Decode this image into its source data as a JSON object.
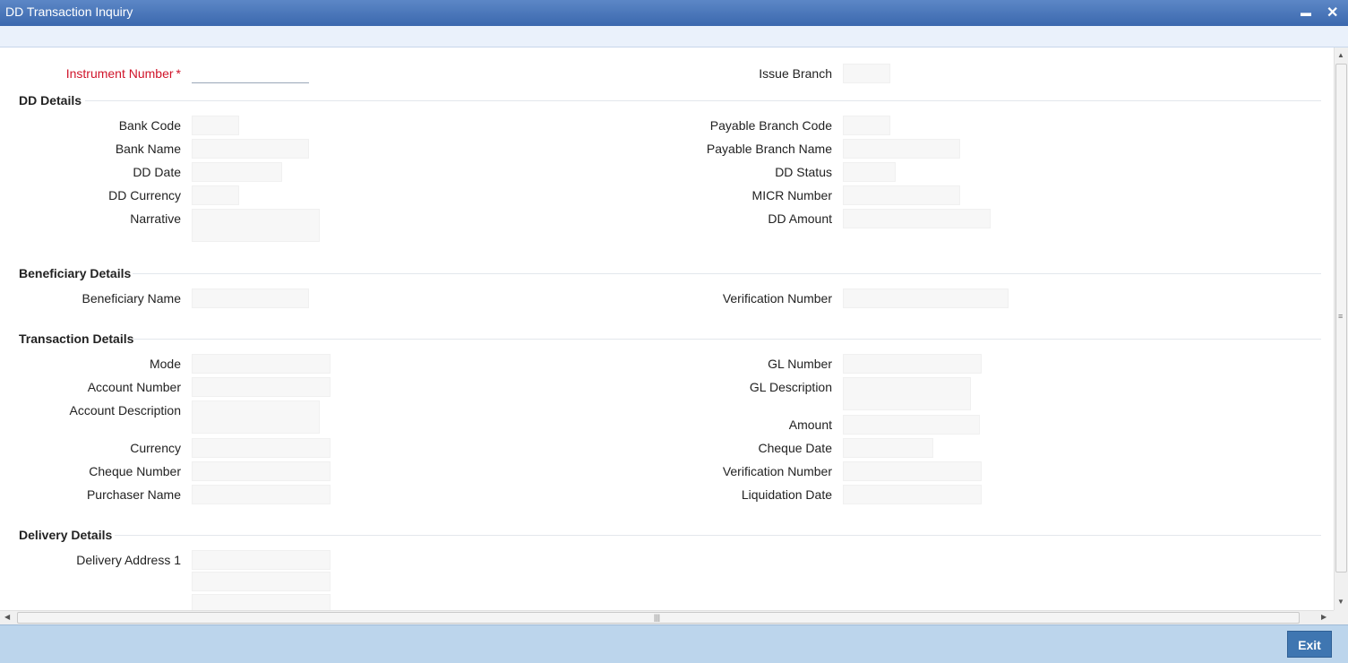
{
  "window": {
    "title": "DD Transaction Inquiry",
    "minimize_glyph": "▬",
    "close_glyph": "✕"
  },
  "header": {
    "instrument_number": {
      "label": "Instrument Number",
      "required_mark": "*",
      "value": ""
    },
    "issue_branch": {
      "label": "Issue Branch",
      "value": ""
    }
  },
  "dd_details": {
    "title": "DD Details",
    "bank_code": "Bank Code",
    "bank_name": "Bank Name",
    "dd_date": "DD Date",
    "dd_currency": "DD Currency",
    "narrative": "Narrative",
    "payable_branch_code": "Payable Branch Code",
    "payable_branch_name": "Payable Branch Name",
    "dd_status": "DD Status",
    "micr_number": "MICR Number",
    "dd_amount": "DD Amount"
  },
  "beneficiary_details": {
    "title": "Beneficiary Details",
    "beneficiary_name": "Beneficiary Name",
    "verification_number": "Verification Number"
  },
  "transaction_details": {
    "title": "Transaction Details",
    "mode": "Mode",
    "account_number": "Account Number",
    "account_description": "Account Description",
    "currency": "Currency",
    "cheque_number": "Cheque Number",
    "purchaser_name": "Purchaser Name",
    "gl_number": "GL Number",
    "gl_description": "GL Description",
    "amount": "Amount",
    "cheque_date": "Cheque Date",
    "verification_number": "Verification Number",
    "liquidation_date": "Liquidation Date"
  },
  "delivery_details": {
    "title": "Delivery Details",
    "delivery_address_1": "Delivery Address 1"
  },
  "footer": {
    "exit_label": "Exit"
  },
  "colors": {
    "titlebar": "#3b68ae",
    "required": "#d0142a",
    "footer": "#bcd5ec",
    "exit_button": "#3f76b1"
  }
}
